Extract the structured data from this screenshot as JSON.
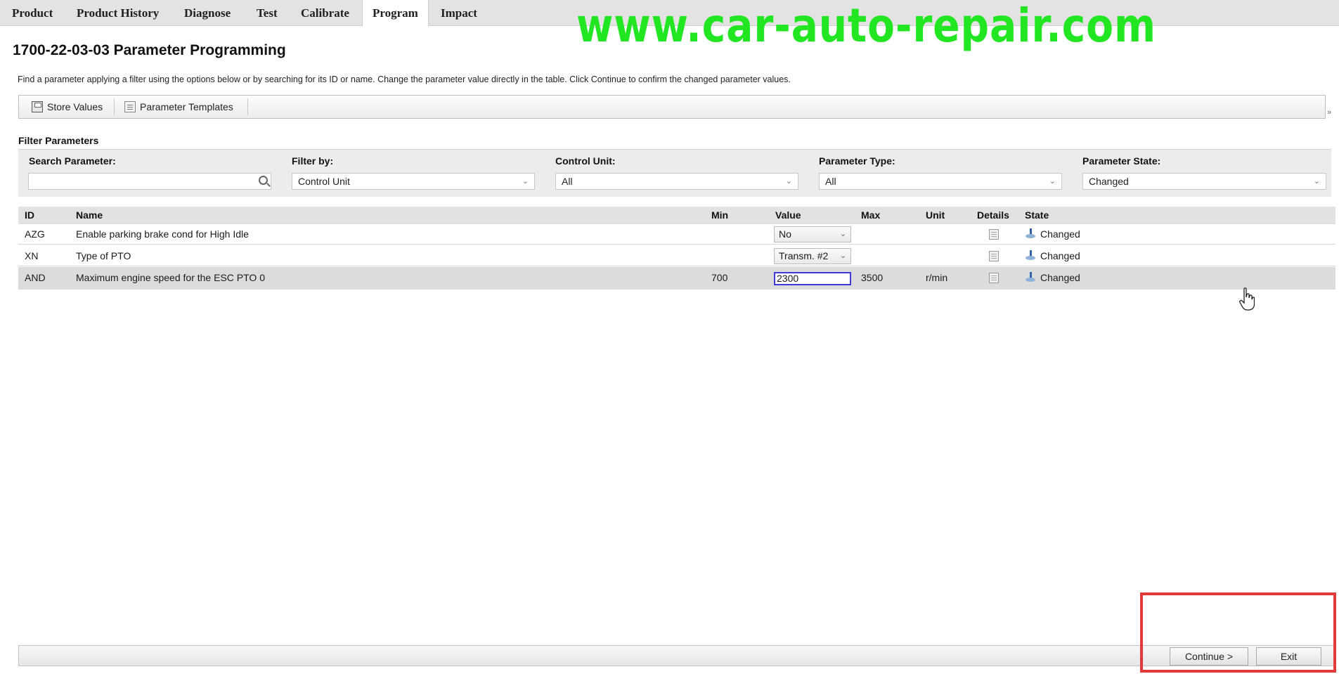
{
  "nav": {
    "tabs": [
      {
        "label": "Product"
      },
      {
        "label": "Product History"
      },
      {
        "label": "Diagnose"
      },
      {
        "label": "Test"
      },
      {
        "label": "Calibrate"
      },
      {
        "label": "Program"
      },
      {
        "label": "Impact"
      }
    ],
    "active_tab": "Program"
  },
  "watermark": "www.car-auto-repair.com",
  "page": {
    "title": "1700-22-03-03 Parameter Programming",
    "description": "Find a parameter applying a filter using the options below or by searching for its ID or name. Change the parameter value directly in the table. Click Continue to confirm the changed parameter values."
  },
  "toolbar": {
    "store_values": "Store Values",
    "parameter_templates": "Parameter Templates",
    "overflow_glyph": "»"
  },
  "filter": {
    "section_title": "Filter Parameters",
    "search": {
      "label": "Search Parameter:",
      "value": ""
    },
    "filter_by": {
      "label": "Filter by:",
      "value": "Control Unit"
    },
    "control_unit": {
      "label": "Control Unit:",
      "value": "All"
    },
    "parameter_type": {
      "label": "Parameter Type:",
      "value": "All"
    },
    "parameter_state": {
      "label": "Parameter State:",
      "value": "Changed"
    }
  },
  "table": {
    "headers": {
      "id": "ID",
      "name": "Name",
      "min": "Min",
      "value": "Value",
      "max": "Max",
      "unit": "Unit",
      "details": "Details",
      "state": "State"
    },
    "rows": [
      {
        "id": "AZG",
        "name": "Enable parking brake cond for High Idle",
        "min": "",
        "value": "No",
        "max": "",
        "unit": "",
        "state": "Changed"
      },
      {
        "id": "XN",
        "name": "Type of PTO",
        "min": "",
        "value": "Transm. #2",
        "max": "",
        "unit": "",
        "state": "Changed"
      },
      {
        "id": "AND",
        "name": "Maximum engine speed for the ESC PTO 0",
        "min": "700",
        "value": "2300",
        "max": "3500",
        "unit": "r/min",
        "state": "Changed"
      }
    ]
  },
  "footer": {
    "continue": "Continue >",
    "exit": "Exit"
  },
  "colors": {
    "watermark": "#22e622",
    "highlight": "#e23a3a",
    "edit_focus": "#3b3bd8"
  }
}
